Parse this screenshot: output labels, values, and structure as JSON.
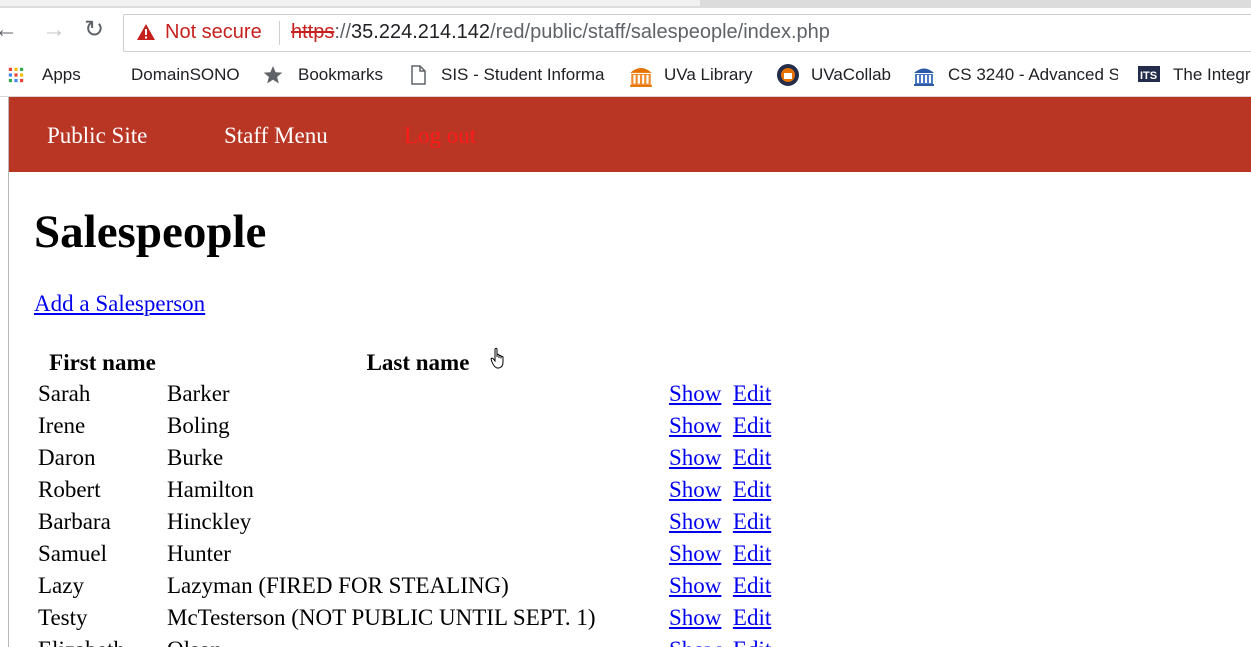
{
  "browser": {
    "security_label": "Not secure",
    "url_scheme": "https",
    "url_host": "35.224.214.142",
    "url_path": "/red/public/staff/salespeople/index.php",
    "bookmarks": [
      {
        "label": "Apps",
        "icon": "apps-grid-icon"
      },
      {
        "label": "DomainSONO",
        "icon": ""
      },
      {
        "label": "Bookmarks",
        "icon": "star-icon"
      },
      {
        "label": "SIS - Student Informa",
        "icon": "page-icon"
      },
      {
        "label": "UVa Library",
        "icon": "library-icon"
      },
      {
        "label": "UVaCollab",
        "icon": "collab-icon"
      },
      {
        "label": "CS 3240 - Advanced S",
        "icon": "rotunda-icon"
      },
      {
        "label": "The Integr",
        "icon": "its-icon"
      }
    ]
  },
  "nav": {
    "public_site": "Public Site",
    "staff_menu": "Staff Menu",
    "log_out": "Log out"
  },
  "page": {
    "title": "Salespeople",
    "add_link": "Add a Salesperson"
  },
  "table": {
    "headers": [
      "First name",
      "Last name"
    ],
    "show_label": "Show",
    "edit_label": "Edit",
    "rows": [
      {
        "first": "Sarah",
        "last": "Barker"
      },
      {
        "first": "Irene",
        "last": "Boling"
      },
      {
        "first": "Daron",
        "last": "Burke"
      },
      {
        "first": "Robert",
        "last": "Hamilton"
      },
      {
        "first": "Barbara",
        "last": "Hinckley"
      },
      {
        "first": "Samuel",
        "last": "Hunter"
      },
      {
        "first": "Lazy",
        "last": "Lazyman (FIRED FOR STEALING)"
      },
      {
        "first": "Testy",
        "last": "McTesterson (NOT PUBLIC UNTIL SEPT. 1)"
      },
      {
        "first": "Elizabeth",
        "last": "Olson"
      }
    ]
  },
  "colors": {
    "nav_bg": "#b93524",
    "link": "#0000ee",
    "logout": "#ff1a1a",
    "not_secure": "#c5221f"
  }
}
